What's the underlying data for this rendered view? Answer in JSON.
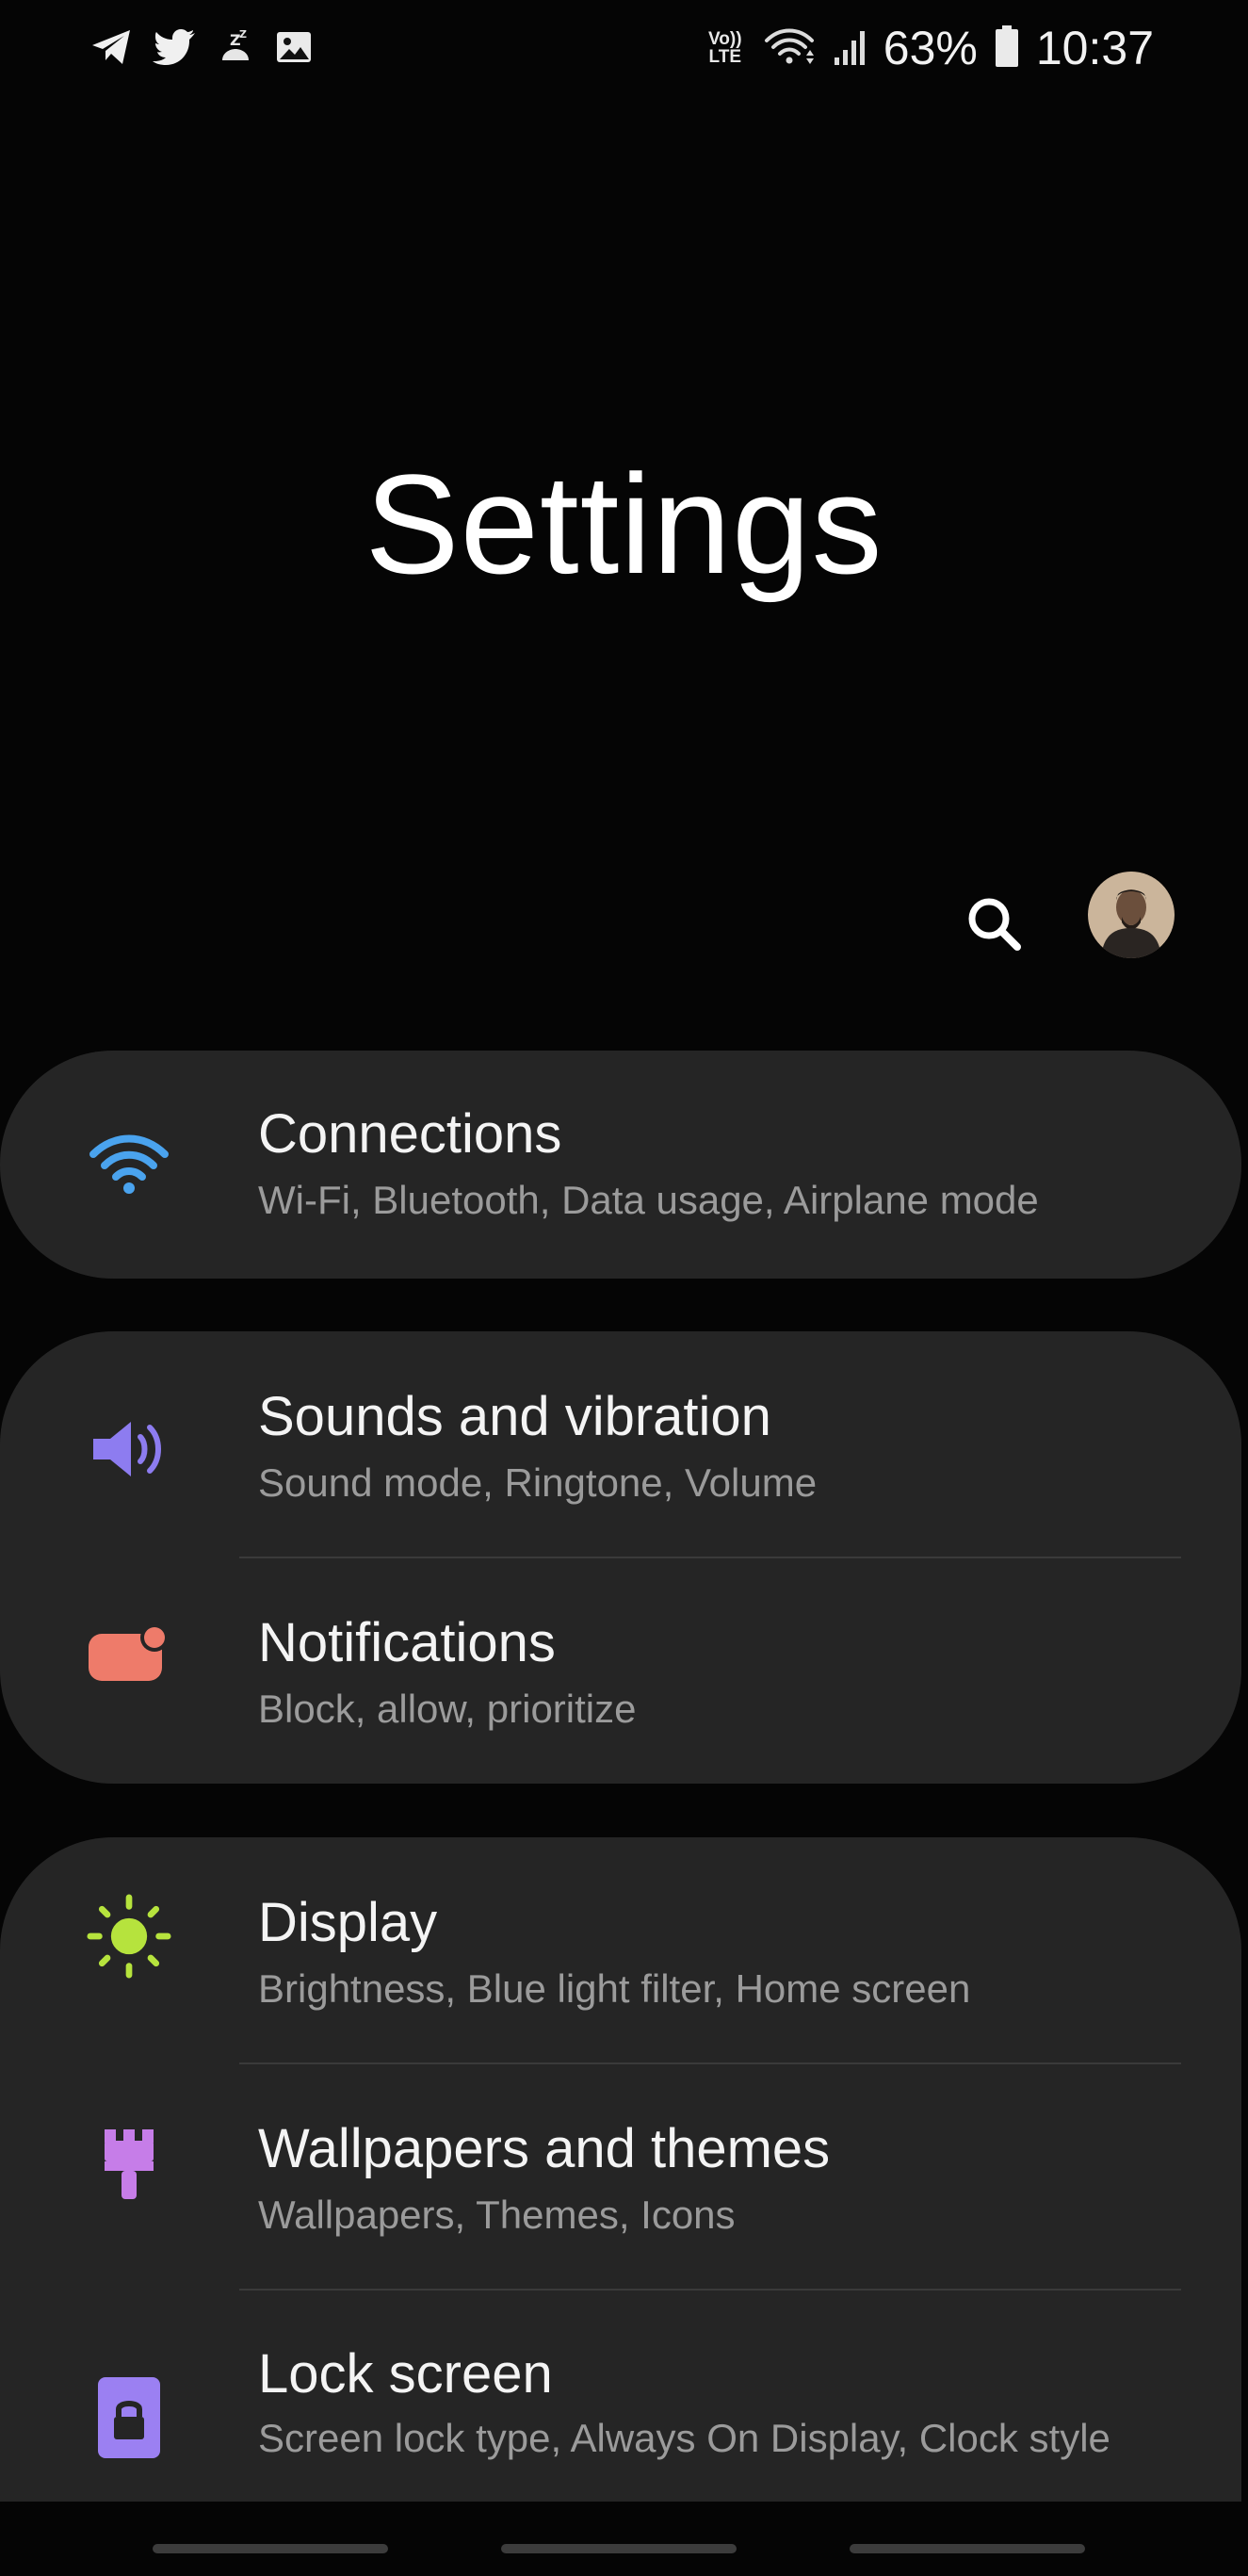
{
  "status_bar": {
    "battery_percent": "63%",
    "time": "10:37",
    "network_badge_top": "Vo))",
    "network_badge_bottom": "LTE",
    "left_icons": [
      "telegram-icon",
      "twitter-icon",
      "missed-call-icon",
      "gallery-icon"
    ],
    "right_icons": [
      "volte-icon",
      "wifi-icon",
      "signal-icon",
      "battery-icon"
    ]
  },
  "header": {
    "title": "Settings"
  },
  "actions": {
    "search_icon": "search-icon",
    "avatar": "profile-avatar"
  },
  "colors": {
    "background": "#050505",
    "card": "#252525",
    "connections": "#4aa3ee",
    "sounds": "#8d7cf0",
    "notifications": "#ee7b6a",
    "display": "#b6e33d",
    "wallpapers": "#c67de8",
    "lock": "#9b80f2"
  },
  "items": {
    "connections": {
      "title": "Connections",
      "subtitle": "Wi-Fi, Bluetooth, Data usage, Airplane mode",
      "icon": "wifi-icon"
    },
    "sounds": {
      "title": "Sounds and vibration",
      "subtitle": "Sound mode, Ringtone, Volume",
      "icon": "speaker-icon"
    },
    "notifications": {
      "title": "Notifications",
      "subtitle": "Block, allow, prioritize",
      "icon": "notification-badge-icon"
    },
    "display": {
      "title": "Display",
      "subtitle": "Brightness, Blue light filter, Home screen",
      "icon": "sun-icon"
    },
    "wallpapers": {
      "title": "Wallpapers and themes",
      "subtitle": "Wallpapers, Themes, Icons",
      "icon": "paint-brush-icon"
    },
    "lock_screen": {
      "title": "Lock screen",
      "subtitle": "Screen lock type, Always On Display, Clock style",
      "icon": "lock-icon"
    }
  }
}
